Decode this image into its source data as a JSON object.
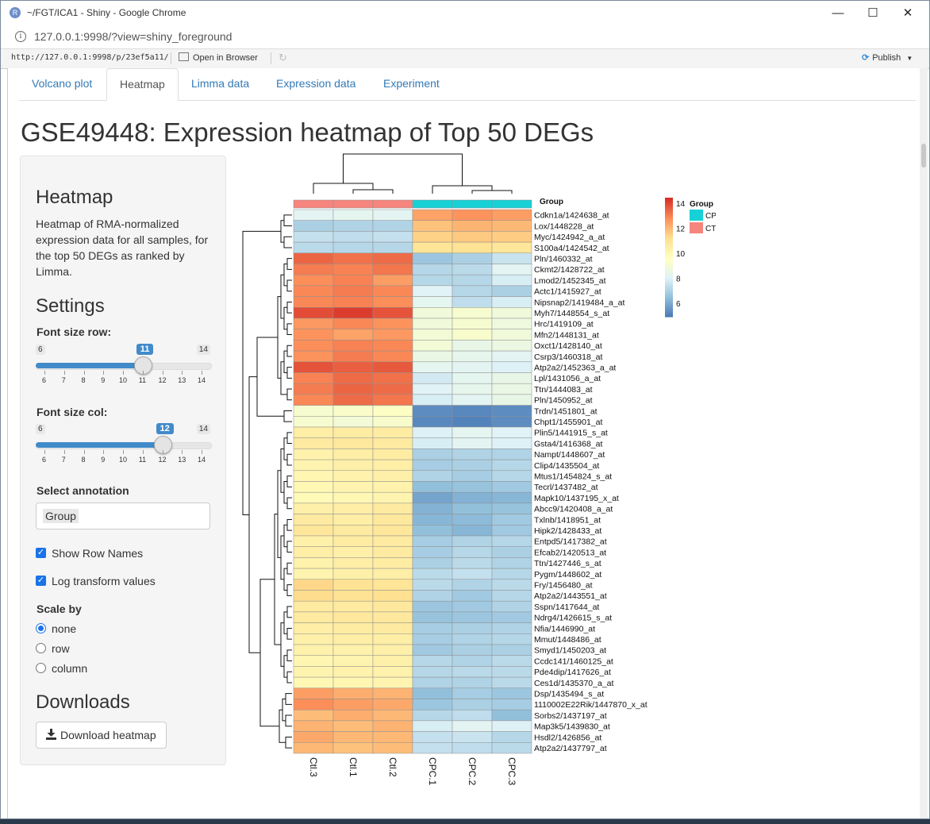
{
  "browser": {
    "window_title": "~/FGT/ICA1 - Shiny - Google Chrome",
    "url": "127.0.0.1:9998/?view=shiny_foreground",
    "app_icon": "R",
    "rstudio_url": "http://127.0.0.1:9998/p/23ef5a11/",
    "open_in_browser": "Open in Browser",
    "publish": "Publish"
  },
  "tabs": [
    {
      "label": "Volcano plot"
    },
    {
      "label": "Heatmap"
    },
    {
      "label": "Limma data"
    },
    {
      "label": "Expression data"
    },
    {
      "label": "Experiment"
    }
  ],
  "page_title": "GSE49448: Expression heatmap of Top 50 DEGs",
  "sidebar": {
    "heatmap_title": "Heatmap",
    "heatmap_desc": "Heatmap of RMA-normalized expression data for all samples, for the top 50 DEGs as ranked by Limma.",
    "settings_title": "Settings",
    "font_row": {
      "label": "Font size row:",
      "min": 6,
      "max": 14,
      "value": 11,
      "min_label": "6",
      "max_label": "14",
      "value_label": "11"
    },
    "font_col": {
      "label": "Font size col:",
      "min": 6,
      "max": 14,
      "value": 12,
      "min_label": "6",
      "max_label": "14",
      "value_label": "12"
    },
    "slider_ticks": [
      "6",
      "7",
      "8",
      "9",
      "10",
      "11",
      "12",
      "13",
      "14"
    ],
    "annotation_label": "Select annotation",
    "annotation_value": "Group",
    "show_row_names": "Show Row Names",
    "log_transform": "Log transform values",
    "scale_label": "Scale by",
    "scale_options": [
      "none",
      "row",
      "column"
    ],
    "scale_selected": "none",
    "downloads_title": "Downloads",
    "download_button": "Download heatmap"
  },
  "chart_data": {
    "type": "heatmap",
    "columns": [
      "Ctl.3",
      "Ctl.1",
      "Ctl.2",
      "CPC.1",
      "CPC.2",
      "CPC.3"
    ],
    "column_groups": [
      "CTL",
      "CTL",
      "CTL",
      "CPC",
      "CPC",
      "CPC"
    ],
    "annotation_title": "Group",
    "legend": {
      "title": "Group",
      "entries": [
        {
          "label": "CPC",
          "color": "#17d1d6"
        },
        {
          "label": "CTL",
          "color": "#f6857d"
        }
      ]
    },
    "color_scale": {
      "ticks": [
        14,
        12,
        10,
        8,
        6
      ],
      "low": 5,
      "high": 14.5,
      "colors": [
        "#4575b4",
        "#91bfdb",
        "#e0f3f8",
        "#ffffbf",
        "#fee090",
        "#fc8d59",
        "#d73027"
      ]
    },
    "rows": [
      {
        "gene": "Cdkn1a/1424638_at",
        "values": [
          8.3,
          8.4,
          8.3,
          12.5,
          12.8,
          12.6
        ]
      },
      {
        "gene": "Lox/1448228_at",
        "values": [
          7.1,
          7.2,
          7.2,
          11.9,
          12.2,
          12.1
        ]
      },
      {
        "gene": "Myc/1424942_a_at",
        "values": [
          7.6,
          7.5,
          7.6,
          11.6,
          11.8,
          11.7
        ]
      },
      {
        "gene": "S100a4/1424542_at",
        "values": [
          7.4,
          7.3,
          7.3,
          11.1,
          11.2,
          11.0
        ]
      },
      {
        "gene": "Pln/1460332_at",
        "values": [
          13.6,
          13.4,
          13.5,
          6.8,
          7.1,
          7.7
        ]
      },
      {
        "gene": "Ckmt2/1428722_at",
        "values": [
          13.2,
          13.1,
          13.3,
          7.3,
          7.4,
          8.3
        ]
      },
      {
        "gene": "Lmod2/1452345_at",
        "values": [
          12.9,
          13.1,
          12.6,
          7.3,
          7.3,
          8.0
        ]
      },
      {
        "gene": "Actc1/1415927_at",
        "values": [
          13.0,
          13.2,
          13.0,
          8.2,
          7.3,
          7.1
        ]
      },
      {
        "gene": "Nipsnap2/1419484_a_at",
        "values": [
          13.0,
          13.1,
          12.9,
          8.4,
          7.5,
          8.0
        ]
      },
      {
        "gene": "Myh7/1448554_s_at",
        "values": [
          14.0,
          14.3,
          13.9,
          9.0,
          9.3,
          9.0
        ]
      },
      {
        "gene": "Hrc/1419109_at",
        "values": [
          12.7,
          13.0,
          12.8,
          9.0,
          9.3,
          8.9
        ]
      },
      {
        "gene": "Mfn2/1448131_at",
        "values": [
          12.8,
          12.5,
          12.7,
          9.1,
          9.4,
          9.0
        ]
      },
      {
        "gene": "Oxct1/1428140_at",
        "values": [
          12.9,
          13.1,
          13.0,
          9.1,
          8.6,
          8.8
        ]
      },
      {
        "gene": "Csrp3/1460318_at",
        "values": [
          12.8,
          13.2,
          13.0,
          8.7,
          8.5,
          8.3
        ]
      },
      {
        "gene": "Atp2a2/1452363_a_at",
        "values": [
          13.9,
          13.7,
          13.8,
          8.4,
          8.3,
          8.1
        ]
      },
      {
        "gene": "Lpl/1431056_a_at",
        "values": [
          13.1,
          13.5,
          13.4,
          7.9,
          8.4,
          8.6
        ]
      },
      {
        "gene": "Ttn/1444083_at",
        "values": [
          13.2,
          13.6,
          13.5,
          8.2,
          8.5,
          8.7
        ]
      },
      {
        "gene": "Pln/1450952_at",
        "values": [
          13.0,
          13.5,
          13.3,
          8.0,
          8.3,
          8.6
        ]
      },
      {
        "gene": "Trdn/1451801_at",
        "values": [
          9.3,
          9.5,
          9.6,
          5.5,
          5.4,
          5.5
        ]
      },
      {
        "gene": "Chpt1/1455901_at",
        "values": [
          9.3,
          9.1,
          9.4,
          5.4,
          5.3,
          5.5
        ]
      },
      {
        "gene": "Plin5/1441915_s_at",
        "values": [
          10.6,
          10.7,
          10.7,
          8.1,
          8.4,
          8.2
        ]
      },
      {
        "gene": "Gsta4/1416368_at",
        "values": [
          10.8,
          10.9,
          10.8,
          8.0,
          8.3,
          8.1
        ]
      },
      {
        "gene": "Nampt/1448607_at",
        "values": [
          10.4,
          10.6,
          10.7,
          7.1,
          7.2,
          7.2
        ]
      },
      {
        "gene": "Clip4/1435504_at",
        "values": [
          10.3,
          10.5,
          10.6,
          7.0,
          7.1,
          7.3
        ]
      },
      {
        "gene": "Mtus1/1454824_s_at",
        "values": [
          10.2,
          10.4,
          10.5,
          7.2,
          7.0,
          7.3
        ]
      },
      {
        "gene": "Tecrl/1437482_at",
        "values": [
          10.1,
          10.3,
          10.4,
          6.6,
          6.7,
          6.9
        ]
      },
      {
        "gene": "Mapk10/1437195_x_at",
        "values": [
          10.0,
          10.1,
          10.3,
          6.0,
          6.3,
          6.4
        ]
      },
      {
        "gene": "Abcc9/1420408_a_at",
        "values": [
          10.5,
          10.6,
          10.8,
          6.3,
          6.6,
          6.7
        ]
      },
      {
        "gene": "Txlnb/1418951_at",
        "values": [
          10.8,
          10.6,
          10.9,
          6.4,
          6.5,
          6.9
        ]
      },
      {
        "gene": "Hipk2/1428433_at",
        "values": [
          11.0,
          10.8,
          11.0,
          6.6,
          6.4,
          6.9
        ]
      },
      {
        "gene": "Entpd5/1417382_at",
        "values": [
          10.5,
          10.7,
          10.8,
          7.0,
          7.2,
          7.3
        ]
      },
      {
        "gene": "Efcab2/1420513_at",
        "values": [
          10.6,
          10.5,
          10.8,
          7.0,
          7.3,
          7.1
        ]
      },
      {
        "gene": "Ttn/1427446_s_at",
        "values": [
          10.4,
          10.6,
          10.7,
          7.1,
          7.4,
          7.2
        ]
      },
      {
        "gene": "Pygm/1448602_at",
        "values": [
          10.3,
          10.5,
          10.6,
          7.4,
          7.6,
          7.3
        ]
      },
      {
        "gene": "Fry/1456480_at",
        "values": [
          11.5,
          11.2,
          11.1,
          7.4,
          7.2,
          7.4
        ]
      },
      {
        "gene": "Atp2a2/1443551_at",
        "values": [
          11.4,
          11.2,
          11.3,
          7.2,
          6.9,
          7.3
        ]
      },
      {
        "gene": "Sspn/1417644_at",
        "values": [
          10.8,
          10.8,
          10.9,
          6.8,
          6.9,
          7.2
        ]
      },
      {
        "gene": "Ndrg4/1426615_s_at",
        "values": [
          10.8,
          10.9,
          10.9,
          6.7,
          6.8,
          6.9
        ]
      },
      {
        "gene": "Nfia/1446990_at",
        "values": [
          10.6,
          10.7,
          10.8,
          7.0,
          7.1,
          7.2
        ]
      },
      {
        "gene": "Mmut/1448486_at",
        "values": [
          10.5,
          10.6,
          10.6,
          7.0,
          7.2,
          7.3
        ]
      },
      {
        "gene": "Smyd1/1450203_at",
        "values": [
          10.4,
          10.4,
          10.5,
          6.9,
          7.1,
          7.1
        ]
      },
      {
        "gene": "Ccdc141/1460125_at",
        "values": [
          10.2,
          10.3,
          10.5,
          7.3,
          7.2,
          7.4
        ]
      },
      {
        "gene": "Pde4dip/1417626_at",
        "values": [
          10.3,
          10.4,
          10.4,
          7.3,
          7.4,
          7.4
        ]
      },
      {
        "gene": "Ces1d/1435370_a_at",
        "values": [
          10.1,
          10.2,
          10.3,
          7.2,
          7.2,
          7.4
        ]
      },
      {
        "gene": "Dsp/1435494_s_at",
        "values": [
          12.6,
          12.3,
          12.2,
          6.6,
          7.0,
          6.8
        ]
      },
      {
        "gene": "1110002E22Rik/1447870_x_at",
        "values": [
          12.9,
          12.6,
          12.4,
          6.8,
          7.1,
          7.0
        ]
      },
      {
        "gene": "Sorbs2/1437197_at",
        "values": [
          12.0,
          12.3,
          12.1,
          7.3,
          7.5,
          6.6
        ]
      },
      {
        "gene": "Map3k5/1439830_at",
        "values": [
          12.2,
          12.0,
          12.2,
          8.0,
          8.3,
          8.1
        ]
      },
      {
        "gene": "Hsdl2/1426856_at",
        "values": [
          12.4,
          12.1,
          12.1,
          7.6,
          7.7,
          7.3
        ]
      },
      {
        "gene": "Atp2a2/1437797_at",
        "values": [
          12.1,
          11.9,
          12.0,
          7.6,
          7.5,
          7.4
        ]
      }
    ]
  }
}
